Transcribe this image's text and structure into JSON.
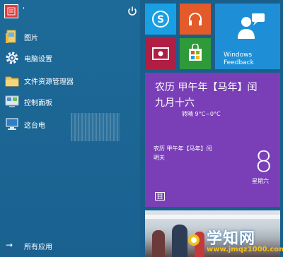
{
  "colors": {
    "left_pane": "#1d6a98",
    "skype_tile": "#19a0e4",
    "music_tile": "#e35b2a",
    "video_tile": "#b01e43",
    "store_tile": "#2f9a3a",
    "feedback_tile": "#1e8fd6",
    "calendar_tile": "#7a3fb7",
    "watermark_url": "#f0c21a"
  },
  "user": {
    "avatar_icon": "user-avatar-icon",
    "name": "'",
    "power_icon": "power-icon"
  },
  "menu": [
    {
      "label": "图片",
      "icon": "pictures-folder-icon"
    },
    {
      "label": "电脑设置",
      "icon": "gear-icon"
    },
    {
      "label": "文件资源管理器",
      "icon": "file-explorer-icon"
    },
    {
      "label": "控制面板",
      "icon": "control-panel-icon"
    },
    {
      "label": "这台电",
      "icon": "this-pc-icon"
    }
  ],
  "all_apps": {
    "label": "所有应用",
    "icon": "arrow-right-icon"
  },
  "tiles": {
    "skype": {
      "icon": "skype-icon"
    },
    "music": {
      "icon": "headphones-icon"
    },
    "video": {
      "icon": "video-icon"
    },
    "store": {
      "icon": "store-icon"
    },
    "feedback": {
      "label_line1": "Windows",
      "label_line2": "Feedback",
      "icon": "feedback-person-icon"
    }
  },
  "calendar": {
    "big_line1": "农历 甲午年【马年】闰",
    "big_line2": "九月十六",
    "temp": "转晴 9°C~0°C",
    "small_line1": "农历 甲午年【马年】闰",
    "small_line2": "明天",
    "day": "8",
    "weekday": "星期六",
    "keyboard_icon": "keyboard-icon"
  },
  "watermark": {
    "title": "学知网",
    "url": "www.jmqz1000.com"
  }
}
